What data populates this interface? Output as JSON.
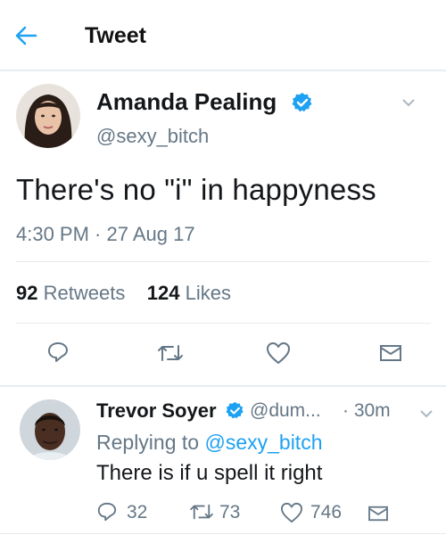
{
  "header": {
    "title": "Tweet",
    "back_icon": "arrow-left-icon",
    "accent": "#1da1f2"
  },
  "tweet": {
    "author_name": "Amanda Pealing",
    "author_handle": "@sexy_bitch",
    "verified": true,
    "text": "There's no \"i\" in happyness",
    "timestamp": "4:30 PM · 27 Aug 17",
    "retweets_count": "92",
    "retweets_label": "Retweets",
    "likes_count": "124",
    "likes_label": "Likes",
    "actions": [
      "reply-icon",
      "retweet-icon",
      "heart-icon",
      "message-icon"
    ]
  },
  "reply": {
    "author_name": "Trevor Soyer",
    "author_handle": "@dum...",
    "time": "· 30m",
    "replying_prefix": "Replying to",
    "replying_to": "@sexy_bitch",
    "text": "There is if u spell it right",
    "reply_count": "32",
    "retweet_count": "73",
    "like_count": "746"
  },
  "colors": {
    "text": "#14171a",
    "muted": "#657786",
    "verified": "#1da1f2",
    "border": "#e6ecf0"
  }
}
